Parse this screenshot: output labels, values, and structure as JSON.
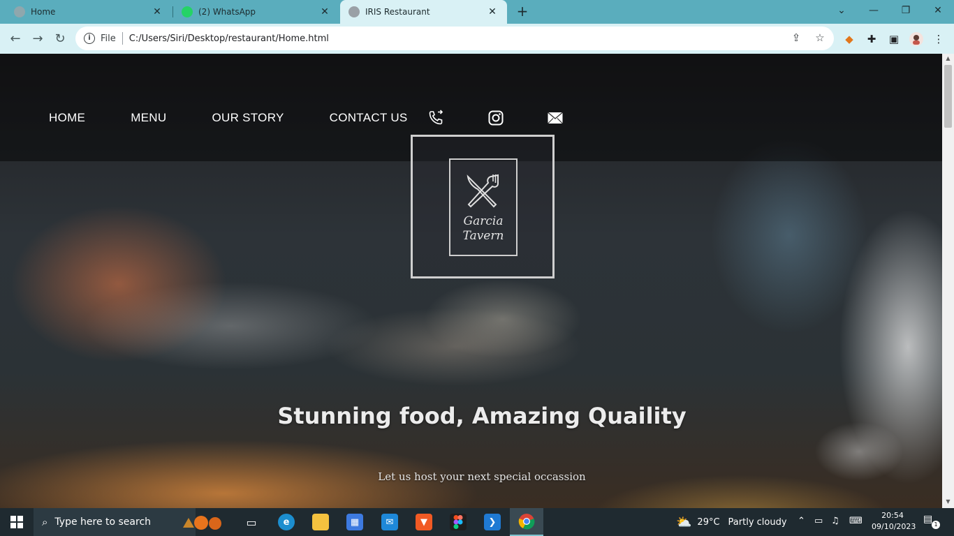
{
  "browser": {
    "tabs": [
      {
        "title": "Home",
        "favicon_color": "#9aa0a6"
      },
      {
        "title": "(2) WhatsApp",
        "favicon_color": "#25d366"
      },
      {
        "title": "IRIS Restaurant",
        "favicon_color": "#9aa0a6"
      }
    ],
    "new_tab_symbol": "+",
    "address": {
      "scheme_label": "File",
      "url": "C:/Users/Siri/Desktop/restaurant/Home.html"
    }
  },
  "page": {
    "nav": {
      "links": [
        "HOME",
        "MENU",
        "OUR STORY",
        "CONTACT US"
      ],
      "icons": [
        "phone-icon",
        "instagram-icon",
        "mail-icon"
      ]
    },
    "logo": {
      "line1": "Garcia",
      "line2": "Tavern"
    },
    "hero": {
      "title": "Stunning food, Amazing Quaility",
      "subtitle": "Let us host your next special occassion"
    }
  },
  "taskbar": {
    "search_placeholder": "Type here to search",
    "weather": {
      "temp": "29°C",
      "condition": "Partly cloudy"
    },
    "clock": {
      "time": "20:54",
      "date": "09/10/2023"
    },
    "notification_count": "1"
  }
}
